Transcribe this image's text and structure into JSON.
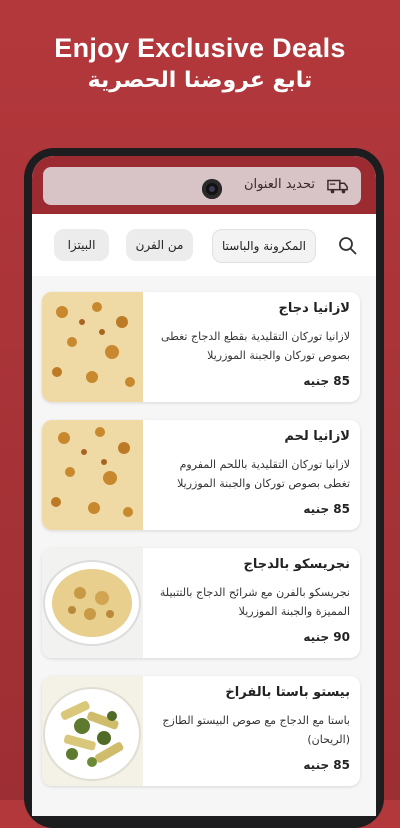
{
  "promo": {
    "headline_en": "Enjoy Exclusive Deals",
    "headline_ar": "تابع عروضنا الحصرية"
  },
  "header": {
    "address_label": "تحديد العنوان",
    "address_icon": "delivery-truck-icon"
  },
  "categories": {
    "search_icon": "search-icon",
    "tabs": [
      {
        "label": "المكرونة والباستا",
        "active": true
      },
      {
        "label": "من الفرن",
        "active": false
      },
      {
        "label": "البيتزا",
        "active": false
      }
    ]
  },
  "menu": {
    "items": [
      {
        "title": "لازانيا دجاج",
        "description": "لازانيا توركان التقليدية بقطع الدجاج تغطى بصوص توركان والجبنة الموزريلا",
        "price": "85 جنيه",
        "image": "chicken-lasagna"
      },
      {
        "title": "لازانيا لحم",
        "description": "لازانيا توركان التقليدية باللحم المفروم تغطى بصوص توركان والجبنة الموزريلا",
        "price": "85 جنيه",
        "image": "beef-lasagna"
      },
      {
        "title": "نجريسكو بالدجاج",
        "description": "نجريسكو بالفرن مع شرائح الدجاج بالتتبيلة المميزة والجبنة الموزريلا",
        "price": "90 جنيه",
        "image": "negresco-chicken"
      },
      {
        "title": "بيستو باستا بالفراخ",
        "description": "باستا مع الدجاج مع صوص البيستو الطازج (الريحان)",
        "price": "85 جنيه",
        "image": "pesto-pasta"
      }
    ]
  },
  "colors": {
    "background": "#b3383c",
    "appbar": "#9b2b30",
    "address_pill": "#d8c3c6"
  }
}
